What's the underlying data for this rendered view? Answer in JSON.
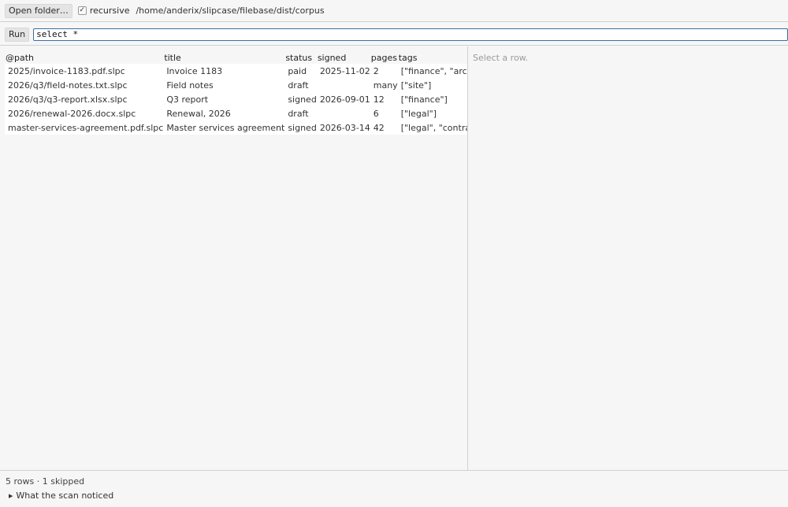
{
  "toolbar": {
    "open_label": "Open folder…",
    "recursive_label": "recursive",
    "recursive_checked": true,
    "check_glyph": "✓",
    "folder_path": "/home/anderix/slipcase/filebase/dist/corpus"
  },
  "query": {
    "run_label": "Run",
    "value": "select *"
  },
  "table": {
    "columns": [
      "@path",
      "title",
      "status",
      "signed",
      "pages",
      "tags"
    ],
    "rows": [
      [
        "2025/invoice-1183.pdf.slpc",
        "Invoice 1183",
        "paid",
        "2025-11-02",
        "2",
        "[\"finance\", \"archiv"
      ],
      [
        "2026/q3/field-notes.txt.slpc",
        "Field notes",
        "draft",
        "",
        "many",
        "[\"site\"]"
      ],
      [
        "2026/q3/q3-report.xlsx.slpc",
        "Q3 report",
        "signed",
        "2026-09-01",
        "12",
        "[\"finance\"]"
      ],
      [
        "2026/renewal-2026.docx.slpc",
        "Renewal, 2026",
        "draft",
        "",
        "6",
        "[\"legal\"]"
      ],
      [
        "master-services-agreement.pdf.slpc",
        "Master services agreement",
        "signed",
        "2026-03-14",
        "42",
        "[\"legal\", \"contract"
      ]
    ]
  },
  "detail": {
    "placeholder": "Select a row."
  },
  "status": {
    "summary": "5 rows · 1 skipped",
    "disclosure_label": "What the scan noticed",
    "disclosure_glyph": "▶"
  },
  "colors": {
    "accent": "#3a6ea5",
    "background": "#f6f6f6",
    "row_background": "#ffffff",
    "border": "#d0d0d0"
  }
}
